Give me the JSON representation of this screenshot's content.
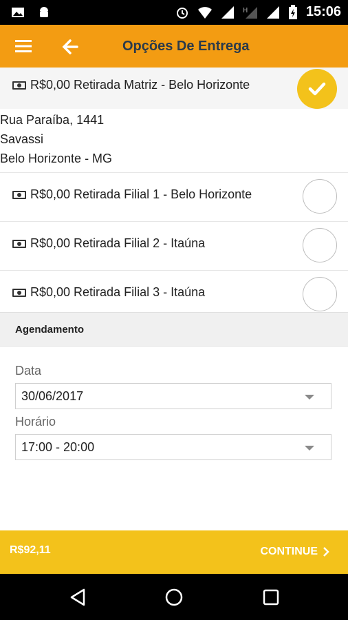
{
  "status_bar": {
    "time": "15:06",
    "icons": [
      "image-icon",
      "android-icon",
      "alarm-icon",
      "wifi-icon",
      "signal-icon",
      "h-signal-icon",
      "signal-icon",
      "battery-icon"
    ]
  },
  "app_bar": {
    "title": "Opções De Entrega",
    "menu_icon": "menu-icon",
    "back_icon": "back-arrow-icon"
  },
  "options": [
    {
      "label": "R$0,00 Retirada Matriz - Belo Horizonte",
      "selected": true
    },
    {
      "label": "R$0,00 Retirada Filial 1 - Belo Horizonte",
      "selected": false
    },
    {
      "label": "R$0,00 Retirada Filial 2 - Itaúna",
      "selected": false
    },
    {
      "label": "R$0,00 Retirada Filial 3 - Itaúna",
      "selected": false
    }
  ],
  "address": {
    "street": "Rua Paraíba, 1441",
    "neighborhood": "Savassi",
    "city": "Belo Horizonte - MG"
  },
  "scheduling": {
    "title": "Agendamento",
    "date_label": "Data",
    "date_value": "30/06/2017",
    "time_label": "Horário",
    "time_value": "17:00 - 20:00"
  },
  "footer": {
    "total": "R$92,11",
    "continue_label": "CONTINUE"
  },
  "colors": {
    "app_bar": "#f39c12",
    "accent": "#f3c21b",
    "title_text": "#2b3a4a"
  }
}
